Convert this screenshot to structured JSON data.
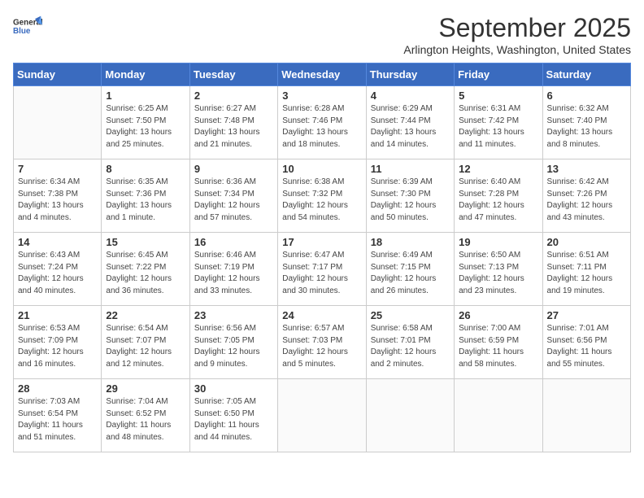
{
  "header": {
    "logo_line1": "General",
    "logo_line2": "Blue",
    "month": "September 2025",
    "location": "Arlington Heights, Washington, United States"
  },
  "weekdays": [
    "Sunday",
    "Monday",
    "Tuesday",
    "Wednesday",
    "Thursday",
    "Friday",
    "Saturday"
  ],
  "weeks": [
    [
      {
        "day": "",
        "sunrise": "",
        "sunset": "",
        "daylight": ""
      },
      {
        "day": "1",
        "sunrise": "Sunrise: 6:25 AM",
        "sunset": "Sunset: 7:50 PM",
        "daylight": "Daylight: 13 hours and 25 minutes."
      },
      {
        "day": "2",
        "sunrise": "Sunrise: 6:27 AM",
        "sunset": "Sunset: 7:48 PM",
        "daylight": "Daylight: 13 hours and 21 minutes."
      },
      {
        "day": "3",
        "sunrise": "Sunrise: 6:28 AM",
        "sunset": "Sunset: 7:46 PM",
        "daylight": "Daylight: 13 hours and 18 minutes."
      },
      {
        "day": "4",
        "sunrise": "Sunrise: 6:29 AM",
        "sunset": "Sunset: 7:44 PM",
        "daylight": "Daylight: 13 hours and 14 minutes."
      },
      {
        "day": "5",
        "sunrise": "Sunrise: 6:31 AM",
        "sunset": "Sunset: 7:42 PM",
        "daylight": "Daylight: 13 hours and 11 minutes."
      },
      {
        "day": "6",
        "sunrise": "Sunrise: 6:32 AM",
        "sunset": "Sunset: 7:40 PM",
        "daylight": "Daylight: 13 hours and 8 minutes."
      }
    ],
    [
      {
        "day": "7",
        "sunrise": "Sunrise: 6:34 AM",
        "sunset": "Sunset: 7:38 PM",
        "daylight": "Daylight: 13 hours and 4 minutes."
      },
      {
        "day": "8",
        "sunrise": "Sunrise: 6:35 AM",
        "sunset": "Sunset: 7:36 PM",
        "daylight": "Daylight: 13 hours and 1 minute."
      },
      {
        "day": "9",
        "sunrise": "Sunrise: 6:36 AM",
        "sunset": "Sunset: 7:34 PM",
        "daylight": "Daylight: 12 hours and 57 minutes."
      },
      {
        "day": "10",
        "sunrise": "Sunrise: 6:38 AM",
        "sunset": "Sunset: 7:32 PM",
        "daylight": "Daylight: 12 hours and 54 minutes."
      },
      {
        "day": "11",
        "sunrise": "Sunrise: 6:39 AM",
        "sunset": "Sunset: 7:30 PM",
        "daylight": "Daylight: 12 hours and 50 minutes."
      },
      {
        "day": "12",
        "sunrise": "Sunrise: 6:40 AM",
        "sunset": "Sunset: 7:28 PM",
        "daylight": "Daylight: 12 hours and 47 minutes."
      },
      {
        "day": "13",
        "sunrise": "Sunrise: 6:42 AM",
        "sunset": "Sunset: 7:26 PM",
        "daylight": "Daylight: 12 hours and 43 minutes."
      }
    ],
    [
      {
        "day": "14",
        "sunrise": "Sunrise: 6:43 AM",
        "sunset": "Sunset: 7:24 PM",
        "daylight": "Daylight: 12 hours and 40 minutes."
      },
      {
        "day": "15",
        "sunrise": "Sunrise: 6:45 AM",
        "sunset": "Sunset: 7:22 PM",
        "daylight": "Daylight: 12 hours and 36 minutes."
      },
      {
        "day": "16",
        "sunrise": "Sunrise: 6:46 AM",
        "sunset": "Sunset: 7:19 PM",
        "daylight": "Daylight: 12 hours and 33 minutes."
      },
      {
        "day": "17",
        "sunrise": "Sunrise: 6:47 AM",
        "sunset": "Sunset: 7:17 PM",
        "daylight": "Daylight: 12 hours and 30 minutes."
      },
      {
        "day": "18",
        "sunrise": "Sunrise: 6:49 AM",
        "sunset": "Sunset: 7:15 PM",
        "daylight": "Daylight: 12 hours and 26 minutes."
      },
      {
        "day": "19",
        "sunrise": "Sunrise: 6:50 AM",
        "sunset": "Sunset: 7:13 PM",
        "daylight": "Daylight: 12 hours and 23 minutes."
      },
      {
        "day": "20",
        "sunrise": "Sunrise: 6:51 AM",
        "sunset": "Sunset: 7:11 PM",
        "daylight": "Daylight: 12 hours and 19 minutes."
      }
    ],
    [
      {
        "day": "21",
        "sunrise": "Sunrise: 6:53 AM",
        "sunset": "Sunset: 7:09 PM",
        "daylight": "Daylight: 12 hours and 16 minutes."
      },
      {
        "day": "22",
        "sunrise": "Sunrise: 6:54 AM",
        "sunset": "Sunset: 7:07 PM",
        "daylight": "Daylight: 12 hours and 12 minutes."
      },
      {
        "day": "23",
        "sunrise": "Sunrise: 6:56 AM",
        "sunset": "Sunset: 7:05 PM",
        "daylight": "Daylight: 12 hours and 9 minutes."
      },
      {
        "day": "24",
        "sunrise": "Sunrise: 6:57 AM",
        "sunset": "Sunset: 7:03 PM",
        "daylight": "Daylight: 12 hours and 5 minutes."
      },
      {
        "day": "25",
        "sunrise": "Sunrise: 6:58 AM",
        "sunset": "Sunset: 7:01 PM",
        "daylight": "Daylight: 12 hours and 2 minutes."
      },
      {
        "day": "26",
        "sunrise": "Sunrise: 7:00 AM",
        "sunset": "Sunset: 6:59 PM",
        "daylight": "Daylight: 11 hours and 58 minutes."
      },
      {
        "day": "27",
        "sunrise": "Sunrise: 7:01 AM",
        "sunset": "Sunset: 6:56 PM",
        "daylight": "Daylight: 11 hours and 55 minutes."
      }
    ],
    [
      {
        "day": "28",
        "sunrise": "Sunrise: 7:03 AM",
        "sunset": "Sunset: 6:54 PM",
        "daylight": "Daylight: 11 hours and 51 minutes."
      },
      {
        "day": "29",
        "sunrise": "Sunrise: 7:04 AM",
        "sunset": "Sunset: 6:52 PM",
        "daylight": "Daylight: 11 hours and 48 minutes."
      },
      {
        "day": "30",
        "sunrise": "Sunrise: 7:05 AM",
        "sunset": "Sunset: 6:50 PM",
        "daylight": "Daylight: 11 hours and 44 minutes."
      },
      {
        "day": "",
        "sunrise": "",
        "sunset": "",
        "daylight": ""
      },
      {
        "day": "",
        "sunrise": "",
        "sunset": "",
        "daylight": ""
      },
      {
        "day": "",
        "sunrise": "",
        "sunset": "",
        "daylight": ""
      },
      {
        "day": "",
        "sunrise": "",
        "sunset": "",
        "daylight": ""
      }
    ]
  ]
}
